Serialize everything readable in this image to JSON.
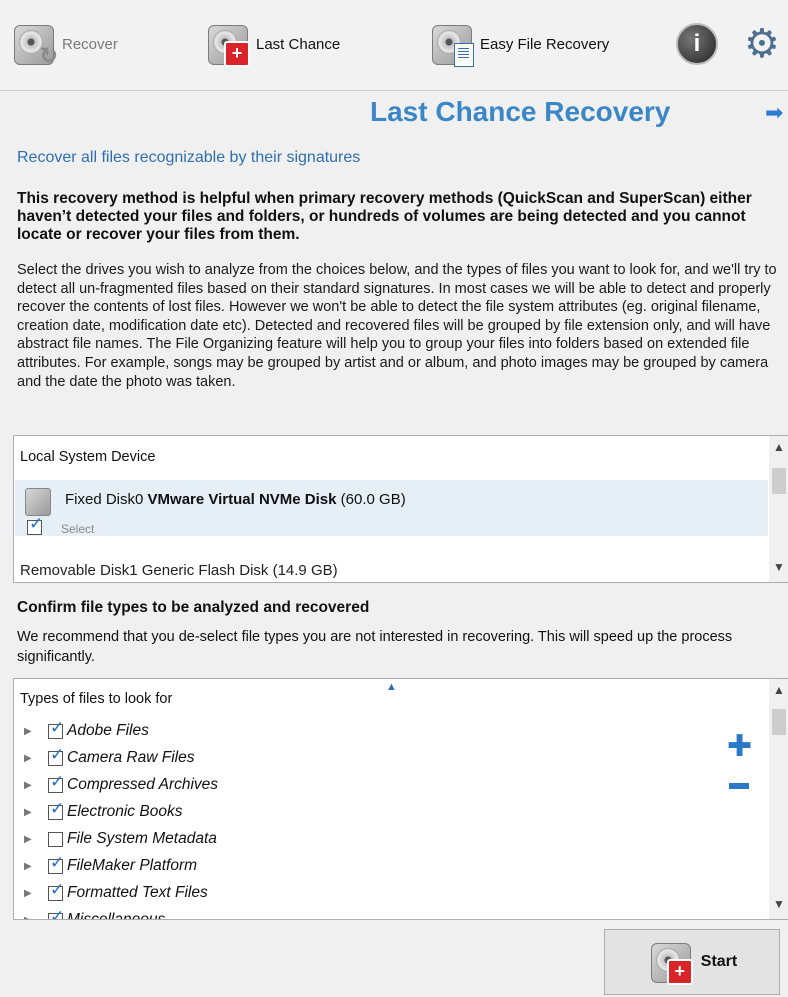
{
  "toolbar": {
    "recover_label": "Recover",
    "last_chance_label": "Last Chance",
    "easy_file_recovery_label": "Easy File Recovery",
    "icons": {
      "recover": "disk-recover-icon",
      "last_chance": "disk-first-aid-icon",
      "easy": "disk-document-icon",
      "info": "info-icon",
      "settings": "gear-icon"
    }
  },
  "page": {
    "title": "Last Chance Recovery",
    "subtitle": "Recover all files recognizable by their signatures",
    "intro_bold": "This recovery method is helpful when primary recovery methods (QuickScan and SuperScan) either haven’t detected your files and folders, or hundreds of volumes are being detected and you cannot locate or recover your files from them.",
    "intro": "Select the drives you wish to analyze from the choices below, and the types of files you want to look for, and we'll try to detect all un-fragmented files based on their standard signatures. In most cases we will be able to detect and properly recover the contents of lost files. However we won't be able to detect the file system attributes (eg. original filename, creation date, modification date etc). Detected and recovered files will be grouped by file extension only, and will have abstract file names. The File Organizing feature will help you to group your files into folders based on extended file attributes. For example, songs may be grouped by artist and or album, and photo images may be grouped by camera and the date the photo was taken."
  },
  "devices": {
    "header": "Local System Device",
    "items": [
      {
        "prefix": "Fixed Disk0 ",
        "model": "VMware Virtual NVMe Disk",
        "size": " (60.0 GB)",
        "select_label": "Select",
        "selected": true
      },
      {
        "text": "Removable Disk1 Generic Flash Disk (14.9 GB)"
      }
    ]
  },
  "file_types": {
    "heading": "Confirm file types to be analyzed and recovered",
    "recommendation": "We recommend that you de-select file types you are not interested in recovering. This will speed up the process significantly.",
    "list_header": "Types of files to look for",
    "items": [
      {
        "label": "Adobe Files",
        "checked": true
      },
      {
        "label": "Camera Raw Files",
        "checked": true
      },
      {
        "label": "Compressed Archives",
        "checked": true
      },
      {
        "label": "Electronic Books",
        "checked": true
      },
      {
        "label": "File System Metadata",
        "checked": false
      },
      {
        "label": "FileMaker Platform",
        "checked": true
      },
      {
        "label": "Formatted Text Files",
        "checked": true
      },
      {
        "label": "Miscellaneous",
        "checked": true
      }
    ]
  },
  "actions": {
    "start_label": "Start"
  },
  "colors": {
    "title": "#3b86c6",
    "subtitle": "#2e6fae",
    "accent": "#2a78c8",
    "selection": "#e6eef6",
    "badge": "#d9252a"
  }
}
